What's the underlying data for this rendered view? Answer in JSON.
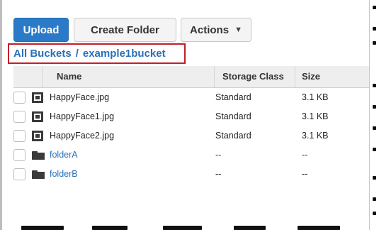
{
  "toolbar": {
    "upload_label": "Upload",
    "create_folder_label": "Create Folder",
    "actions_label": "Actions"
  },
  "breadcrumb": {
    "root": "All Buckets",
    "separator": "/",
    "bucket": "example1bucket"
  },
  "table": {
    "headers": {
      "name": "Name",
      "storage_class": "Storage Class",
      "size": "Size"
    },
    "rows": [
      {
        "type": "file",
        "name": "HappyFace.jpg",
        "storage_class": "Standard",
        "size": "3.1 KB"
      },
      {
        "type": "file",
        "name": "HappyFace1.jpg",
        "storage_class": "Standard",
        "size": "3.1 KB"
      },
      {
        "type": "file",
        "name": "HappyFace2.jpg",
        "storage_class": "Standard",
        "size": "3.1 KB"
      },
      {
        "type": "folder",
        "name": "folderA",
        "storage_class": "--",
        "size": "--"
      },
      {
        "type": "folder",
        "name": "folderB",
        "storage_class": "--",
        "size": "--"
      }
    ]
  },
  "colors": {
    "primary_button": "#2b7ac8",
    "link": "#2a70b8",
    "highlight_box": "#c0202a",
    "header_bg": "#eeeeee"
  },
  "icons": {
    "file": "file-icon",
    "folder": "folder-icon",
    "dropdown": "chevron-down-icon"
  }
}
